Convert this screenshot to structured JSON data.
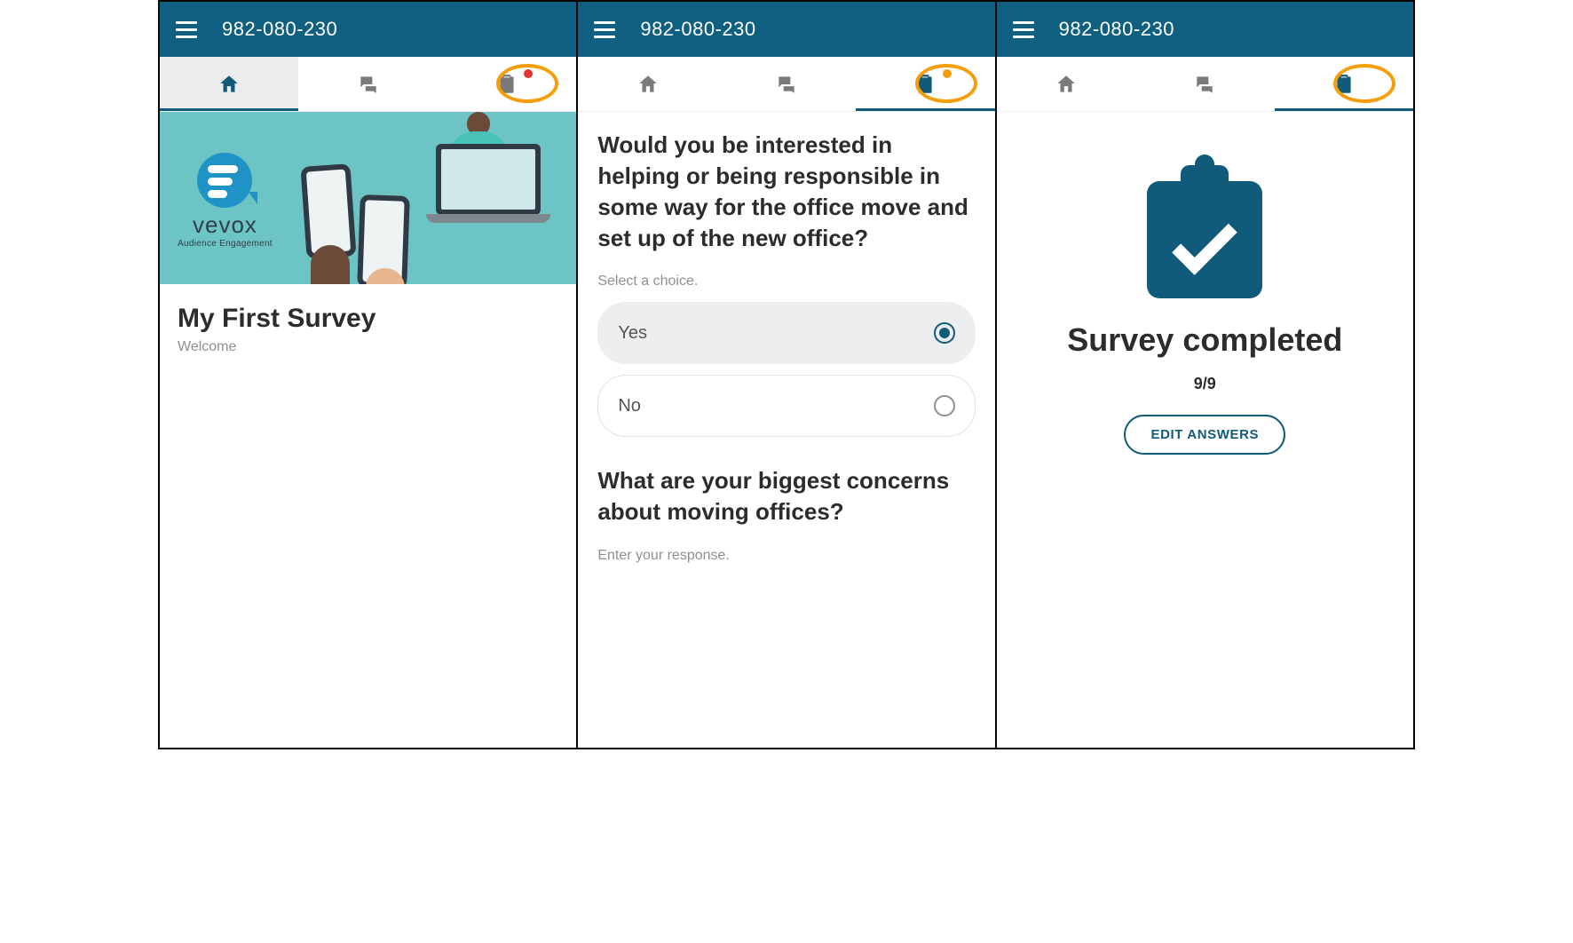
{
  "session_id": "982-080-230",
  "brand": {
    "name": "vevox",
    "tagline": "Audience Engagement"
  },
  "screen1": {
    "title": "My First Survey",
    "subtitle": "Welcome"
  },
  "screen2": {
    "question1": "Would you be interested in helping or being responsible in some way for the office move and set up of the new office?",
    "hint1": "Select a choice.",
    "options": [
      {
        "label": "Yes",
        "selected": true
      },
      {
        "label": "No",
        "selected": false
      }
    ],
    "question2": "What are your biggest concerns about moving offices?",
    "hint2": "Enter your response."
  },
  "screen3": {
    "title": "Survey completed",
    "progress": "9/9",
    "edit_label": "EDIT ANSWERS"
  }
}
